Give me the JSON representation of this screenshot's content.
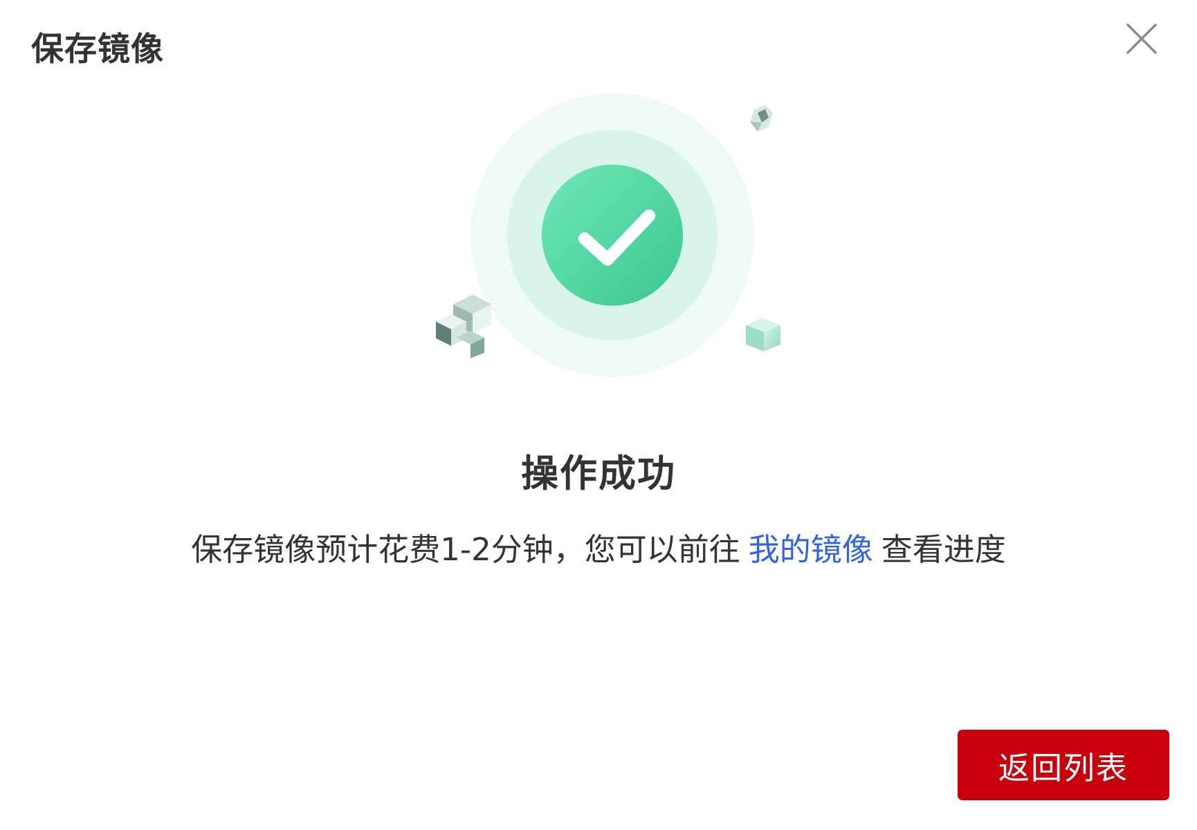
{
  "dialog": {
    "title": "保存镜像"
  },
  "result": {
    "status_title": "操作成功",
    "description_prefix": "保存镜像预计花费1-2分钟，您可以前往",
    "description_link": "我的镜像",
    "description_suffix": "查看进度"
  },
  "footer": {
    "back_button_label": "返回列表"
  },
  "icons": {
    "close": "close-icon",
    "success": "success-check-icon"
  },
  "colors": {
    "primary_button": "#c7000b",
    "link": "#2e64e5",
    "success_green": "#3fcf9a"
  }
}
